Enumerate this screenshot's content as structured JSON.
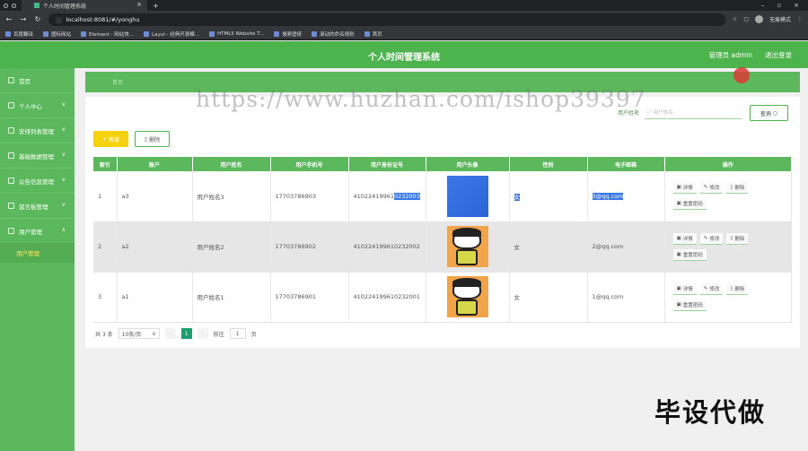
{
  "browser": {
    "tab_title": "个人时间管理系统",
    "url": "localhost:8081/#/yonghu",
    "profile_label": "无痕模式",
    "bookmarks": [
      "百度翻译",
      "图标网站",
      "Element - 网站快...",
      "Layui - 经典开源模...",
      "HTML5 Website T...",
      "搜索壁纸",
      "滚动的命名规则",
      "首页"
    ]
  },
  "header": {
    "title": "个人时间管理系统",
    "admin_label": "管理员 admin",
    "logout_label": "退出登录"
  },
  "sidebar": {
    "items": [
      {
        "label": "首页",
        "has_arrow": false
      },
      {
        "label": "个人中心",
        "has_arrow": true
      },
      {
        "label": "安排列表管理",
        "has_arrow": true
      },
      {
        "label": "基础数据管理",
        "has_arrow": true
      },
      {
        "label": "公告信息管理",
        "has_arrow": true
      },
      {
        "label": "留言板管理",
        "has_arrow": true
      },
      {
        "label": "用户管理",
        "has_arrow": true
      }
    ],
    "active_sub": "用户管理"
  },
  "breadcrumb": "首页",
  "search": {
    "label": "用户姓名",
    "placeholder": "用户姓名",
    "button_label": "查询"
  },
  "toolbar": {
    "add_label": "新增",
    "delete_label": "删除"
  },
  "table": {
    "headers": [
      "索引",
      "账户",
      "用户姓名",
      "用户手机号",
      "用户身份证号",
      "用户头像",
      "性别",
      "电子邮箱",
      "操作"
    ],
    "rows": [
      {
        "index": "1",
        "account": "a3",
        "name": "用户姓名3",
        "phone": "17703786903",
        "id_prefix": "41022419961",
        "id_suffix": "0232003",
        "avatar": "blue",
        "gender": "女",
        "email": "3@qq.com",
        "selected": true
      },
      {
        "index": "2",
        "account": "a2",
        "name": "用户姓名2",
        "phone": "17703786902",
        "id_prefix": "410224199610232002",
        "id_suffix": "",
        "avatar": "cartoon",
        "gender": "女",
        "email": "2@qq.com",
        "selected": false
      },
      {
        "index": "3",
        "account": "a1",
        "name": "用户姓名1",
        "phone": "17703786901",
        "id_prefix": "410224199610232001",
        "id_suffix": "",
        "avatar": "cartoon",
        "gender": "女",
        "email": "1@qq.com",
        "selected": false
      }
    ],
    "row_actions": [
      "详情",
      "修改",
      "删除",
      "重置密码"
    ]
  },
  "pager": {
    "total_label": "共 3 条",
    "page_size": "10条/页",
    "current_page": "1",
    "goto_label": "前往",
    "goto_value": "1",
    "page_suffix": "页"
  },
  "watermark": "https://www.huzhan.com/ishop39397",
  "corner_text": "毕设代做",
  "colors": {
    "primary_green": "#4db34d",
    "sidebar_green": "#5cb85c",
    "add_yellow": "#f5d20c",
    "active_page": "#1a9e6d",
    "selection_blue": "#3b78e7"
  }
}
